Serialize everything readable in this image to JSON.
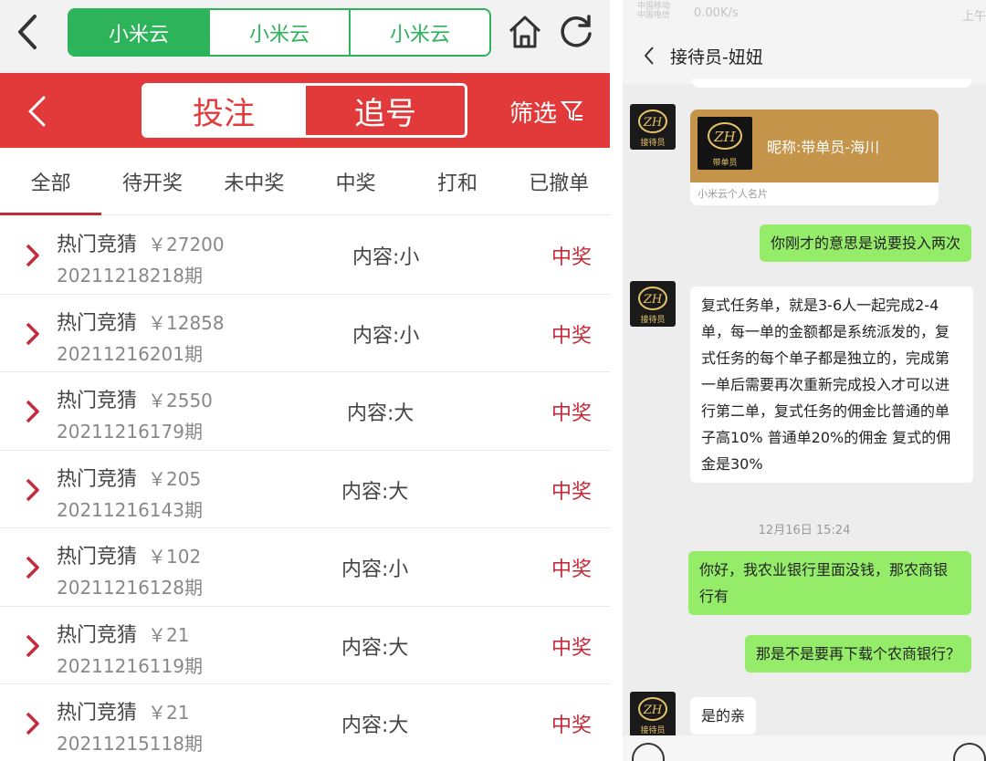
{
  "left": {
    "segments": [
      "小米云",
      "小米云",
      "小米云"
    ],
    "toggle": {
      "active": "投注",
      "inactive": "追号"
    },
    "filter_label": "筛选",
    "tabs": [
      "全部",
      "待开奖",
      "未中奖",
      "中奖",
      "打和",
      "已撤单"
    ],
    "rows": [
      {
        "name": "热门竞猜",
        "amount": "￥27200",
        "period": "20211218218期",
        "content": "内容:小",
        "result": "中奖"
      },
      {
        "name": "热门竞猜",
        "amount": "￥12858",
        "period": "20211216201期",
        "content": "内容:小",
        "result": "中奖"
      },
      {
        "name": "热门竞猜",
        "amount": "￥2550",
        "period": "20211216179期",
        "content": "内容:大",
        "result": "中奖"
      },
      {
        "name": "热门竞猜",
        "amount": "￥205",
        "period": "20211216143期",
        "content": "内容:大",
        "result": "中奖"
      },
      {
        "name": "热门竞猜",
        "amount": "￥102",
        "period": "20211216128期",
        "content": "内容:小",
        "result": "中奖"
      },
      {
        "name": "热门竞猜",
        "amount": "￥21",
        "period": "20211216119期",
        "content": "内容:大",
        "result": "中奖"
      },
      {
        "name": "热门竞猜",
        "amount": "￥21",
        "period": "20211215118期",
        "content": "内容:大",
        "result": "中奖"
      }
    ]
  },
  "right": {
    "status": {
      "carrier1": "中国移动",
      "carrier2": "中国电信",
      "net_speed": "0.00K/s",
      "time": "上午"
    },
    "chat_title": "接待员-妞妞",
    "avatar_label": "接待员",
    "card": {
      "img_label": "带单员",
      "nickname": "昵称:带单员-海川",
      "footer": "小米云个人名片"
    },
    "messages": [
      {
        "side": "right",
        "text": "你刚才的意思是说要投入两次"
      },
      {
        "side": "left",
        "text": "复式任务单，就是3-6人一起完成2-4单，每一单的金额都是系统派发的，复式任务的每个单子都是独立的，完成第一单后需要再次重新完成投入才可以进行第二单，复式任务的佣金比普通的单子高10% 普通单20%的佣金 复式的佣金是30%"
      },
      {
        "side": "right",
        "text": "你好，我农业银行里面没钱，那农商银行有"
      },
      {
        "side": "right",
        "text": "那是不是要再下载个农商银行？"
      },
      {
        "side": "left",
        "text": "是的亲"
      }
    ],
    "timestamp": "12月16日 15:24"
  },
  "colors": {
    "green": "#2db35a",
    "red": "#e23a3a",
    "win_red": "#c62a3a",
    "wechat_green": "#95ec69"
  }
}
